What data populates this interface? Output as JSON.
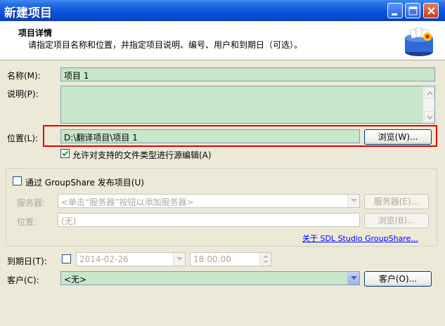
{
  "window": {
    "title": "新建项目",
    "min_icon": "minimize-icon",
    "max_icon": "maximize-icon",
    "close_icon": "close-icon"
  },
  "header": {
    "title": "项目详情",
    "subtitle": "请指定项目名称和位置，并指定项目说明、编号、用户和到期日（可选）。",
    "icon": "project-box-icon"
  },
  "form": {
    "name": {
      "label": "名称(M):",
      "value": "项目 1"
    },
    "description": {
      "label": "说明(P):",
      "value": ""
    },
    "location": {
      "label": "位置(L):",
      "value": "D:\\翻译项目\\项目 1",
      "browse_label": "浏览(W)..."
    },
    "source_edit": {
      "label": "允许对支持的文件类型进行源编辑(A)",
      "checked": true
    }
  },
  "groupshare": {
    "checkbox_label": "通过 GroupShare 发布项目(U)",
    "checked": false,
    "server": {
      "label": "服务器:",
      "placeholder": "<单击“服务器”按钮以添加服务器>",
      "button_label": "服务器(E)..."
    },
    "location": {
      "label": "位置:",
      "value": "(无)",
      "button_label": "浏览(B)..."
    },
    "link": "关于 SDL Studio GroupShare..."
  },
  "due_date": {
    "label": "到期日(T):",
    "checked": false,
    "date": "2014-02-26",
    "time": "18:00:00"
  },
  "customer": {
    "label": "客户(C):",
    "value": "<无>",
    "button_label": "客户(O)..."
  },
  "colors": {
    "title_bar": "#0c55de",
    "field_bg": "#c8e6c9",
    "highlight": "#e00000",
    "link": "#0000ff"
  }
}
